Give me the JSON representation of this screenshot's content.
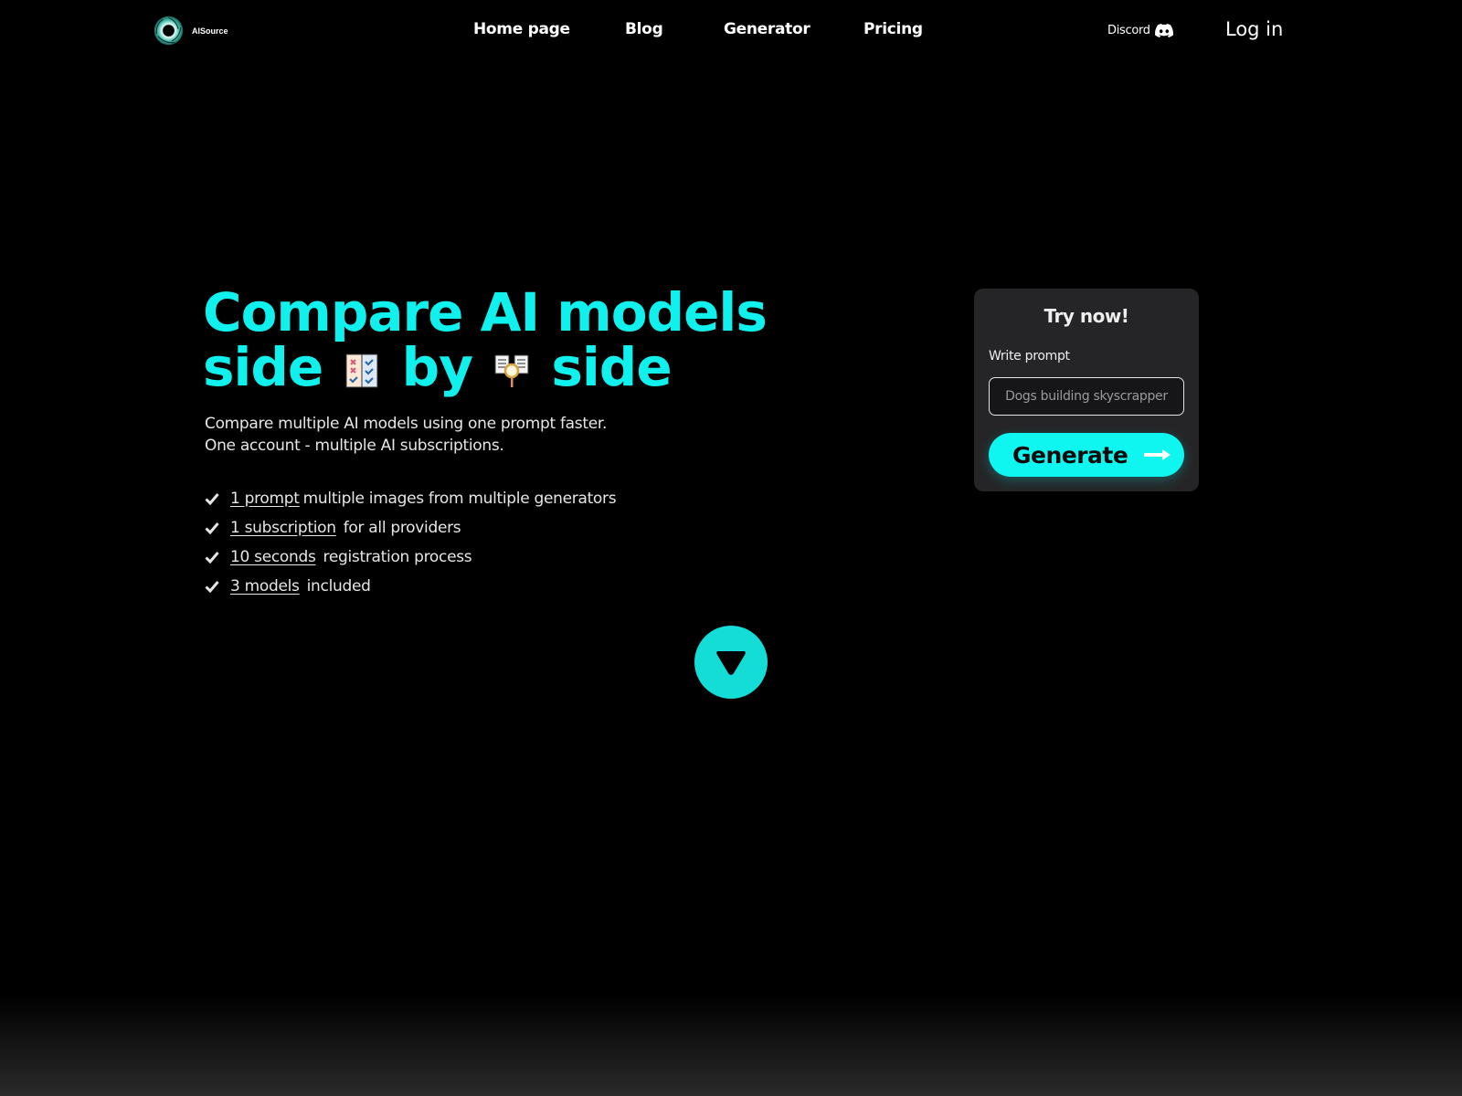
{
  "header": {
    "logo_text": "AISource",
    "nav": [
      {
        "label": "Home page"
      },
      {
        "label": "Blog"
      },
      {
        "label": "Generator"
      },
      {
        "label": "Pricing"
      }
    ],
    "discord_label": "Discord",
    "login_label": "Log in"
  },
  "hero": {
    "title_line1": "Compare AI models",
    "title_word_side": "side",
    "title_word_by": "by",
    "title_word_side2": "side",
    "subtitle_line1": "Compare multiple AI models using one prompt faster.",
    "subtitle_line2": "One account - multiple AI subscriptions.",
    "features": [
      {
        "highlight": "1 prompt",
        "text": "multiple images from multiple generators"
      },
      {
        "highlight": "1 subscription",
        "text": "for all providers"
      },
      {
        "highlight": "10 seconds",
        "text": "registration process"
      },
      {
        "highlight": "3 models",
        "text": "included"
      }
    ]
  },
  "try_card": {
    "title": "Try now!",
    "prompt_label": "Write prompt",
    "prompt_placeholder": "Dogs building skyscrapper",
    "prompt_value": "",
    "generate_label": "Generate"
  },
  "colors": {
    "accent": "#10f0ec",
    "background": "#000000",
    "card": "#252527"
  }
}
